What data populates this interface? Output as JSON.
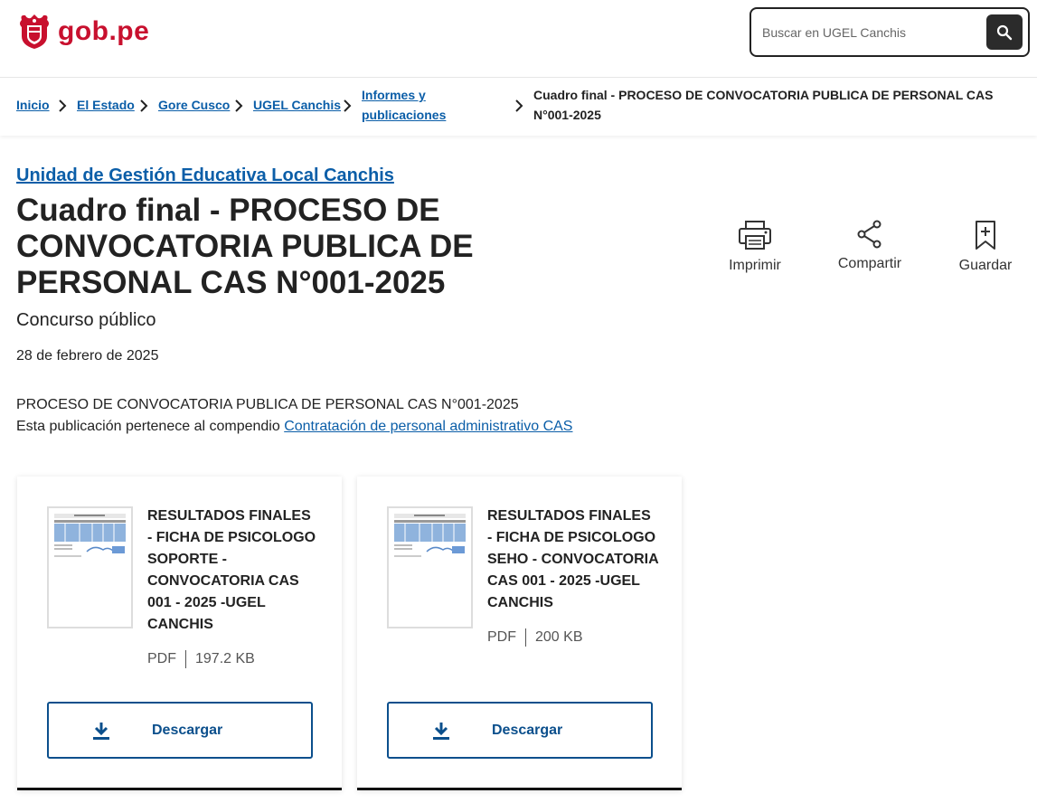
{
  "header": {
    "logo_text": "gob.pe",
    "search_placeholder": "Buscar en UGEL Canchis",
    "brand_color": "#c8102e"
  },
  "breadcrumb": {
    "items": [
      "Inicio",
      "El Estado",
      "Gore Cusco",
      "UGEL Canchis",
      "Informes y publicaciones"
    ],
    "current": "Cuadro final - PROCESO DE CONVOCATORIA PUBLICA DE PERSONAL CAS N°001-2025"
  },
  "main": {
    "org_link": "Unidad de Gestión Educativa Local Canchis",
    "title": "Cuadro final - PROCESO DE CONVOCATORIA PUBLICA DE PERSONAL CAS N°001-2025",
    "subtitle": "Concurso público",
    "date": "28 de febrero de 2025",
    "description": "PROCESO DE CONVOCATORIA PUBLICA DE PERSONAL CAS N°001-2025",
    "compendium_prefix": "Esta publicación pertenece al compendio",
    "compendium_link": "Contratación de personal administrativo CAS"
  },
  "actions": {
    "print": "Imprimir",
    "share": "Compartir",
    "save": "Guardar"
  },
  "documents": [
    {
      "title": "RESULTADOS FINALES - FICHA DE PSICOLOGO SOPORTE - CONVOCATORIA CAS 001 - 2025 -UGEL CANCHIS",
      "format": "PDF",
      "size": "197.2 KB",
      "download_label": "Descargar"
    },
    {
      "title": "RESULTADOS FINALES - FICHA DE PSICOLOGO SEHO - CONVOCATORIA CAS 001 - 2025 -UGEL CANCHIS",
      "format": "PDF",
      "size": "200 KB",
      "download_label": "Descargar"
    }
  ],
  "colors": {
    "link": "#0b5ea8",
    "button_border": "#0b4f8c"
  },
  "icons": [
    "peru-shield-icon",
    "search-icon",
    "chevron-right-icon",
    "printer-icon",
    "share-icon",
    "bookmark-icon",
    "download-icon"
  ]
}
